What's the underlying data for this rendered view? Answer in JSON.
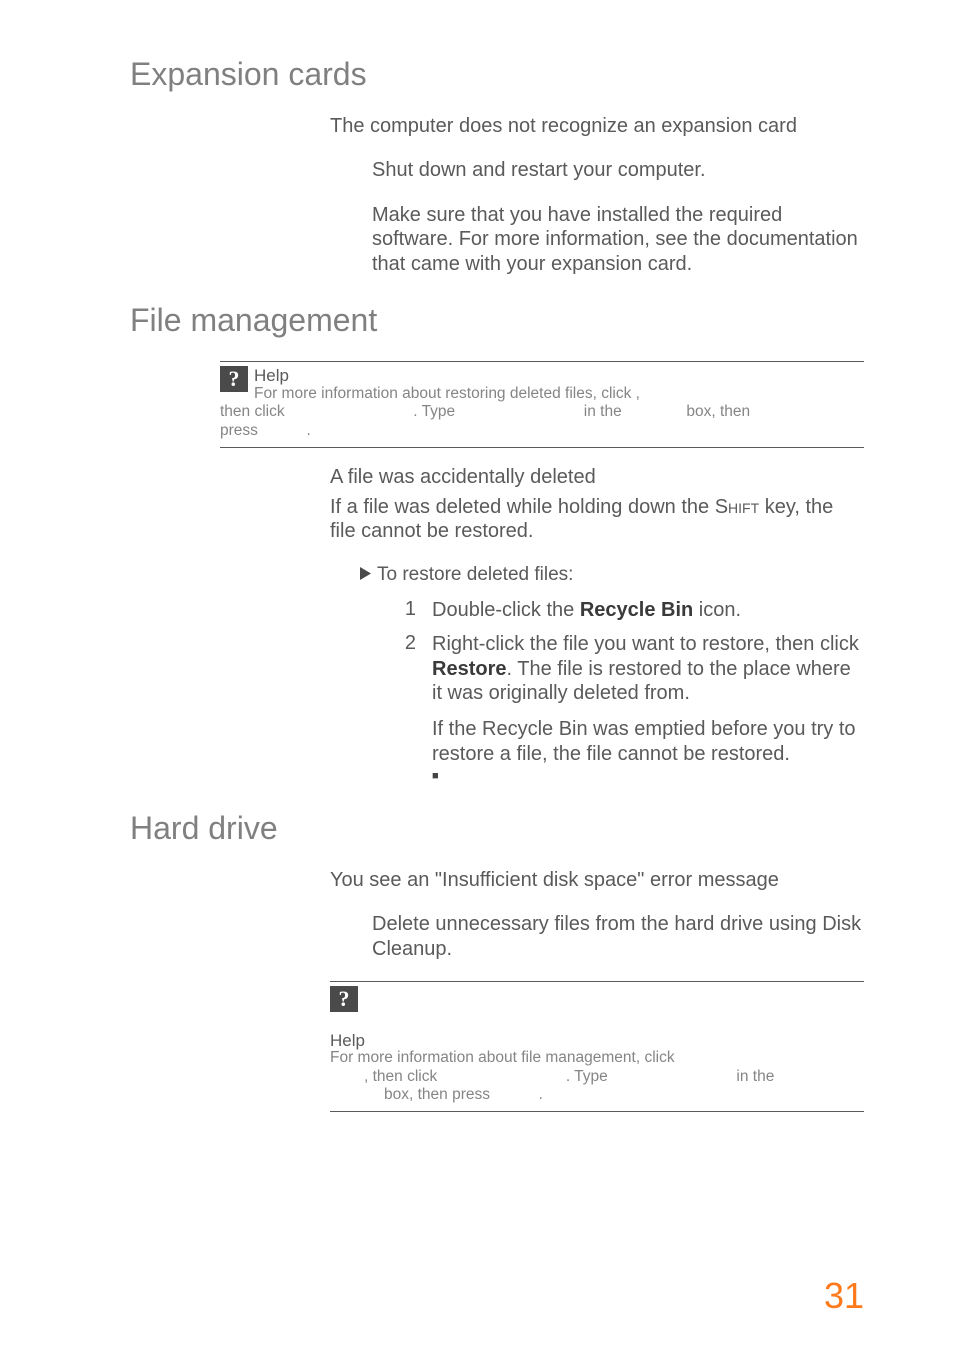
{
  "sections": {
    "expansion": {
      "heading": "Expansion cards",
      "topic_title": "The computer does not recognize an expansion card",
      "bullet1": "Shut down and restart your computer.",
      "bullet2": "Make sure that you have installed the required software. For more information, see the documentation that came with your expansion card."
    },
    "file_mgmt": {
      "heading": "File management",
      "help_label": "Help",
      "help_l1a": "For more information about restoring deleted files, click ",
      "help_l1b": ",",
      "help_l2a": "then click ",
      "help_l2b": ". Type ",
      "help_l2c": " in the ",
      "help_l2d": " box, then",
      "help_l3a": "press ",
      "help_l3b": ".",
      "topic_title": "A file was accidentally deleted",
      "topic_body_a": "If a file was deleted while holding down the ",
      "topic_body_key": "Shift",
      "topic_body_b": " key, the file cannot be restored.",
      "proc_heading": "To restore deleted files:",
      "step1_num": "1",
      "step1_a": "Double-click the ",
      "step1_bold": "Recycle Bin",
      "step1_b": " icon.",
      "step2_num": "2",
      "step2_a": "Right-click the file you want to restore, then click ",
      "step2_bold": "Restore",
      "step2_b": ". The file is restored to the place where it was originally deleted from.",
      "follow": "If the Recycle Bin was emptied before you try to restore a file, the file cannot be restored."
    },
    "hard_drive": {
      "heading": "Hard drive",
      "topic_title": "You see an \"Insufficient disk space\" error message",
      "bullet1": "Delete unnecessary files from the hard drive using Disk Cleanup.",
      "help_label": "Help",
      "help_l1": "For more information about file management, click",
      "help_l2a": ", then click ",
      "help_l2b": ". Type ",
      "help_l2c": " in the",
      "help_l3a": " box, then press ",
      "help_l3b": "."
    }
  },
  "page_number": "31"
}
